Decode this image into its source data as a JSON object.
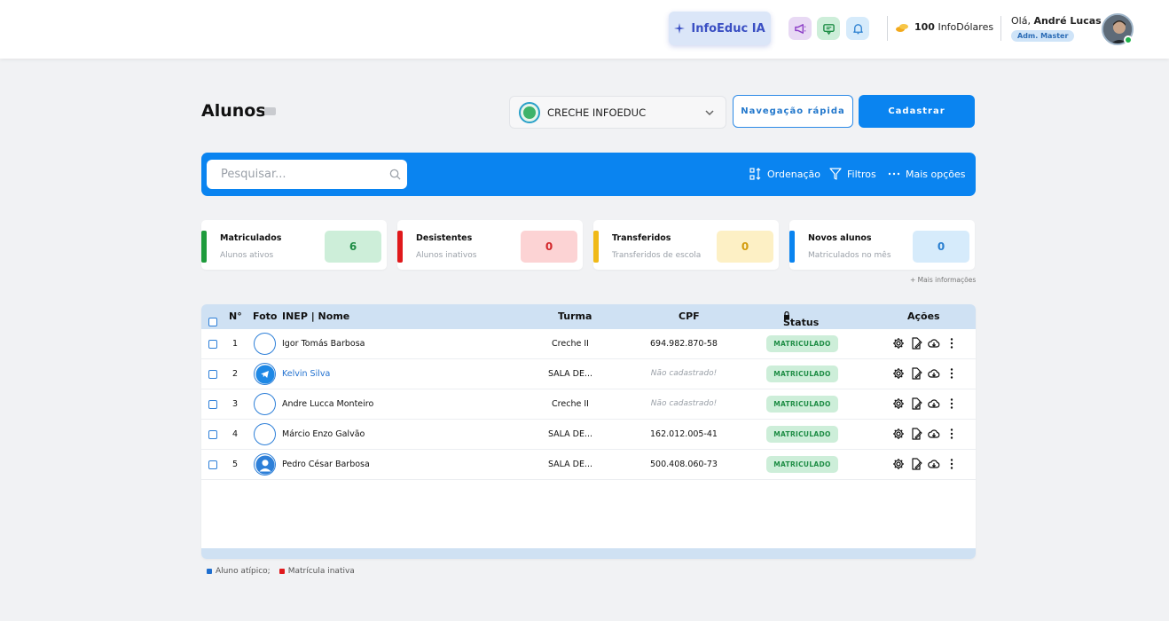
{
  "header": {
    "ia_button": "InfoEduc IA",
    "coins_amount": "100",
    "coins_label": "InfoDólares",
    "greeting": "Olá,",
    "user_name": "André Lucas",
    "role": "Adm. Master",
    "quick_icons": [
      "megaphone-icon",
      "chat-icon",
      "bell-icon"
    ]
  },
  "page": {
    "title": "Alunos",
    "school": "CRECHE INFOEDUC",
    "quick_nav_label": "Navegação rápida",
    "register_label": "Cadastrar"
  },
  "search": {
    "placeholder": "Pesquisar...",
    "sort_label": "Ordenação",
    "filters_label": "Filtros",
    "more_label": "Mais opções"
  },
  "cards": [
    {
      "title": "Matriculados",
      "subtitle": "Alunos ativos",
      "value": "6",
      "accent": "#1e9b3c",
      "bg": "#cdeed9",
      "fg": "#1e8d45"
    },
    {
      "title": "Desistentes",
      "subtitle": "Alunos inativos",
      "value": "0",
      "accent": "#e0191c",
      "bg": "#fcd3d4",
      "fg": "#d3272b"
    },
    {
      "title": "Transferidos",
      "subtitle": "Transferidos de escola",
      "value": "0",
      "accent": "#f0b917",
      "bg": "#fdf0c5",
      "fg": "#d39b0c"
    },
    {
      "title": "Novos alunos",
      "subtitle": "Matriculados no mês",
      "value": "0",
      "accent": "#0a84f0",
      "bg": "#d6ebfb",
      "fg": "#2a7fd0"
    }
  ],
  "more_info": "+ Mais informações",
  "table": {
    "headers": {
      "n": "N°",
      "photo": "Foto",
      "name": "INEP | Nome",
      "turma": "Turma",
      "cpf": "CPF",
      "status": "Status",
      "actions": "Ações"
    },
    "rows": [
      {
        "n": "1",
        "name": "Igor Tomás Barbosa",
        "turma": "Creche II",
        "cpf": "694.982.870-58",
        "status": "MATRICULADO"
      },
      {
        "n": "2",
        "name": "Kelvin Silva",
        "turma": "SALA DE...",
        "cpf": "Não cadastrado!",
        "status": "MATRICULADO"
      },
      {
        "n": "3",
        "name": "Andre Lucca Monteiro",
        "turma": "Creche II",
        "cpf": "Não cadastrado!",
        "status": "MATRICULADO"
      },
      {
        "n": "4",
        "name": "Márcio Enzo Galvão",
        "turma": "SALA DE...",
        "cpf": "162.012.005-41",
        "status": "MATRICULADO"
      },
      {
        "n": "5",
        "name": "Pedro César Barbosa",
        "turma": "SALA DE...",
        "cpf": "500.408.060-73",
        "status": "MATRICULADO"
      }
    ]
  },
  "legend": {
    "atypical": "Aluno atípico;",
    "inactive": "Matrícula inativa",
    "atypical_color": "#1f6fcf",
    "inactive_color": "#e0191c"
  }
}
